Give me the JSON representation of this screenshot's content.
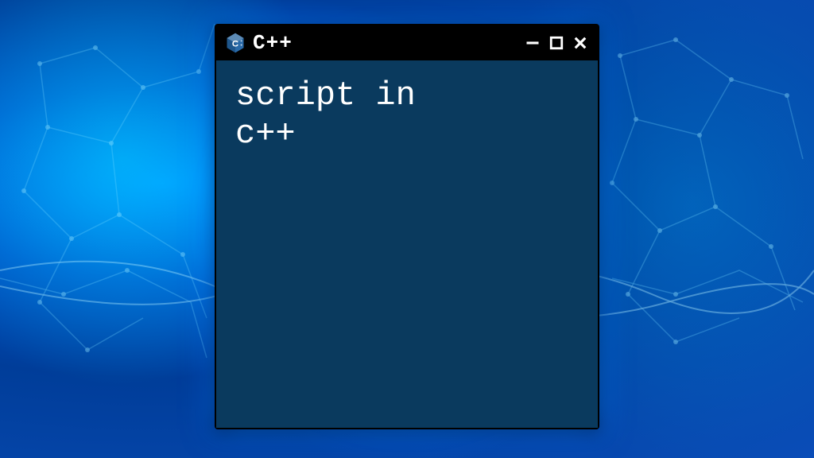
{
  "window": {
    "title": "C++",
    "content": "script in\nc++"
  },
  "icons": {
    "app": "cpp-hexagon",
    "minimize": "minimize-icon",
    "maximize": "maximize-icon",
    "close": "close-icon"
  },
  "colors": {
    "window_bg": "#0a3a5e",
    "titlebar_bg": "#000000",
    "text": "#ffffff",
    "icon_blue": "#1e568c",
    "icon_light": "#5d8bb5"
  }
}
